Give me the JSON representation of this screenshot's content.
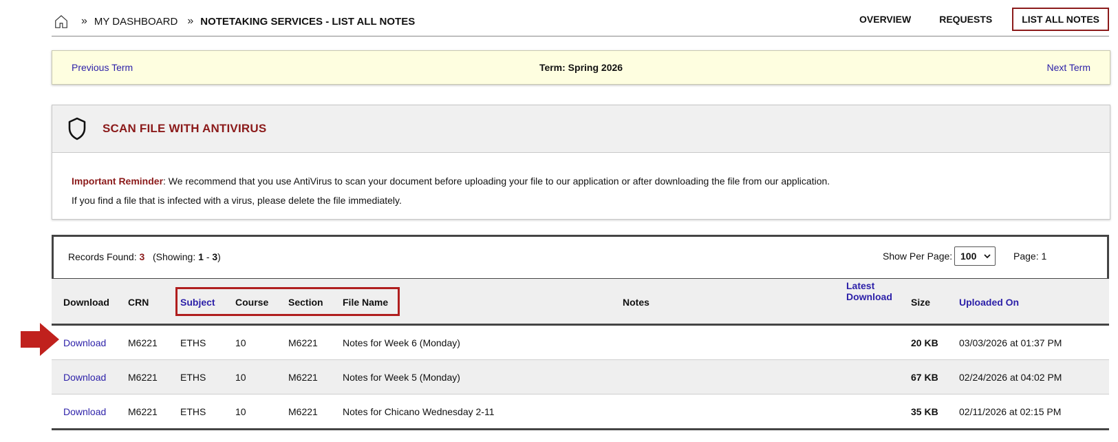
{
  "breadcrumb": {
    "items": [
      "MY DASHBOARD",
      "NOTETAKING SERVICES - LIST ALL NOTES"
    ]
  },
  "nav": {
    "overview": "OVERVIEW",
    "requests": "REQUESTS",
    "list_all_notes": "LIST ALL NOTES"
  },
  "term": {
    "prev": "Previous Term",
    "current": "Term: Spring 2026",
    "next": "Next Term"
  },
  "antivirus": {
    "title": "SCAN FILE WITH ANTIVIRUS",
    "reminder_label": "Important Reminder",
    "reminder_text": ": We recommend that you use AntiVirus to scan your document before uploading your file to our application or after downloading the file from our application.",
    "line2": "If you find a file that is infected with a virus, please delete the file immediately."
  },
  "records": {
    "found_label": "Records Found:",
    "found_count": "3",
    "showing_label": "(Showing:",
    "showing_from": "1",
    "showing_dash": "-",
    "showing_to": "3",
    "showing_close": ")",
    "show_per_page_label": "Show Per Page:",
    "per_page_value": "100",
    "page_label": "Page: 1"
  },
  "table": {
    "headers": {
      "download": "Download",
      "crn": "CRN",
      "subject": "Subject",
      "course": "Course",
      "section": "Section",
      "file_name": "File Name",
      "notes": "Notes",
      "latest_download_1": "Latest",
      "latest_download_2": "Download",
      "size": "Size",
      "uploaded_on": "Uploaded On"
    },
    "rows": [
      {
        "download": "Download",
        "crn": "M6221",
        "subject": "ETHS",
        "course": "10",
        "section": "M6221",
        "file_name": "Notes for Week 6 (Monday)",
        "notes": "",
        "latest_download": "",
        "size": "20 KB",
        "uploaded_on": "03/03/2026 at 01:37 PM"
      },
      {
        "download": "Download",
        "crn": "M6221",
        "subject": "ETHS",
        "course": "10",
        "section": "M6221",
        "file_name": "Notes for Week 5 (Monday)",
        "notes": "",
        "latest_download": "",
        "size": "67 KB",
        "uploaded_on": "02/24/2026 at 04:02 PM"
      },
      {
        "download": "Download",
        "crn": "M6221",
        "subject": "ETHS",
        "course": "10",
        "section": "M6221",
        "file_name": "Notes for Chicano Wednesday 2-11",
        "notes": "",
        "latest_download": "",
        "size": "35 KB",
        "uploaded_on": "02/11/2026 at 02:15 PM"
      }
    ]
  },
  "colors": {
    "accent_red": "#8b1a1a",
    "highlight_red": "#b01e1e",
    "link_blue": "#2b1fa8",
    "term_bar_bg": "#fefee0"
  },
  "icons": {
    "home": "home-icon",
    "breadcrumb_sep": "double-chevron-right-icon",
    "shield": "shield-icon",
    "select_arrow": "chevron-down-icon",
    "pointer_arrow": "red-arrow-right-icon"
  }
}
